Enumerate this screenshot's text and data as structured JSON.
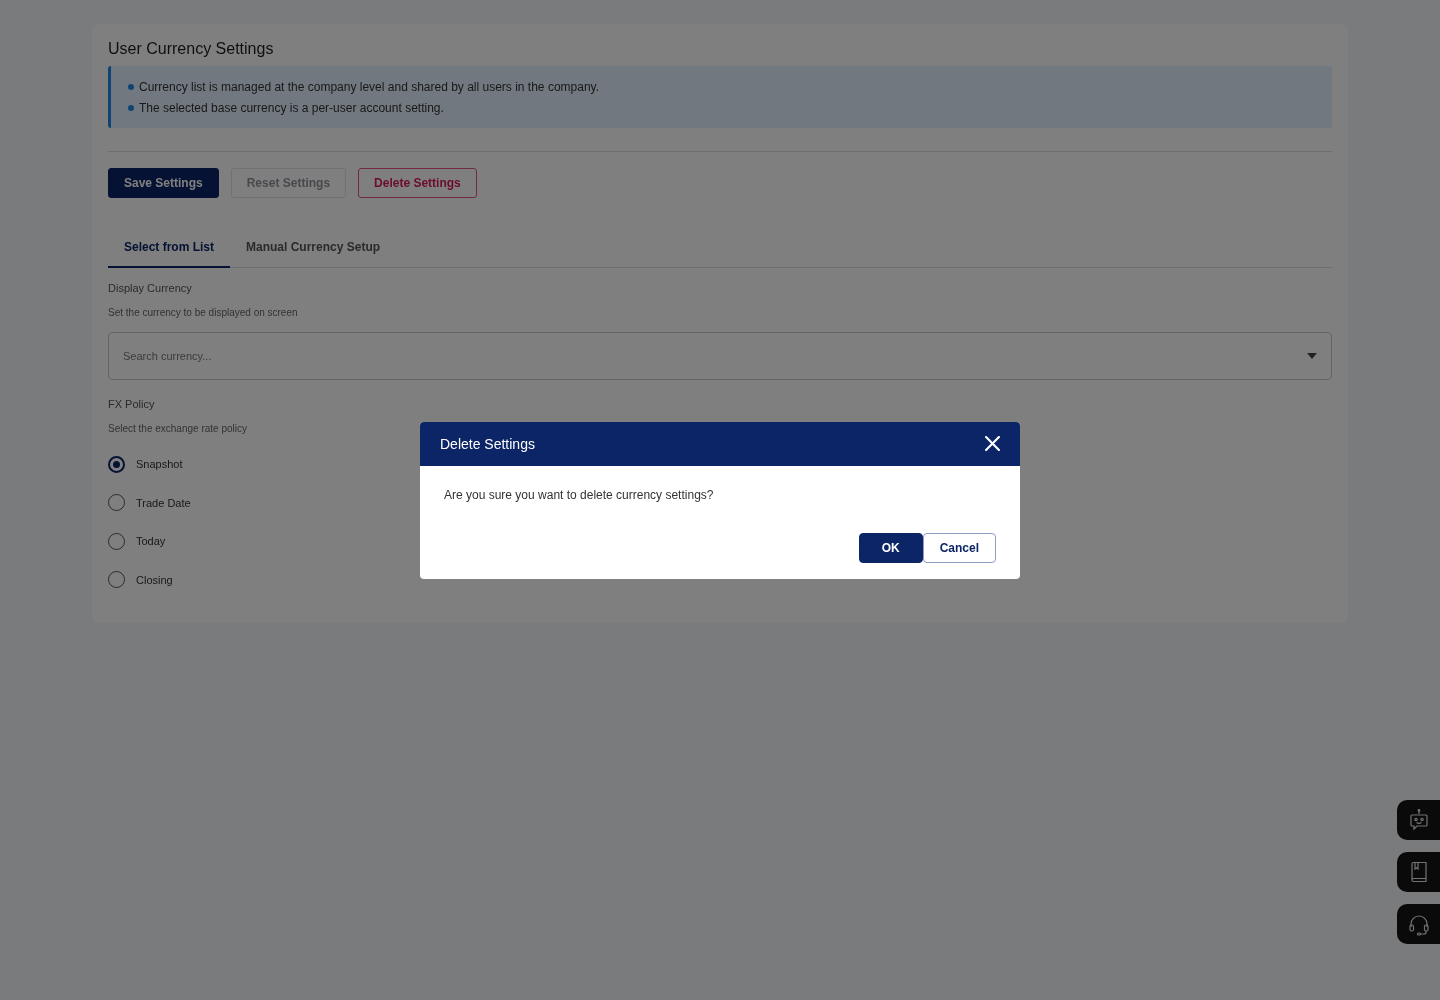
{
  "page": {
    "title": "User Currency Settings",
    "notes": [
      "Currency list is managed at the company level and shared by all users in the company.",
      "The selected base currency is a per-user account setting."
    ]
  },
  "actions": [
    {
      "label": "Save Settings",
      "kind": "primary",
      "disabled": false
    },
    {
      "label": "Reset Settings",
      "kind": "outline",
      "disabled": true
    },
    {
      "label": "Delete Settings",
      "kind": "danger",
      "disabled": false
    }
  ],
  "tabs": [
    {
      "label": "Select from List",
      "selected": true
    },
    {
      "label": "Manual Currency Setup",
      "selected": false
    }
  ],
  "display_currency": {
    "label": "Display Currency",
    "hint": "Set the currency to be displayed on screen",
    "placeholder": "Search currency..."
  },
  "fx_policy": {
    "label": "FX Policy",
    "hint": "Select the exchange rate policy",
    "options": [
      {
        "label": "Snapshot",
        "selected": true
      },
      {
        "label": "Trade Date",
        "selected": false
      },
      {
        "label": "Today",
        "selected": false
      },
      {
        "label": "Closing",
        "selected": false
      }
    ]
  },
  "dialog": {
    "title": "Delete Settings",
    "message": "Are you sure you want to delete currency settings?",
    "buttons": [
      {
        "label": "OK",
        "kind": "primary"
      },
      {
        "label": "Cancel",
        "kind": "secondary"
      }
    ]
  }
}
